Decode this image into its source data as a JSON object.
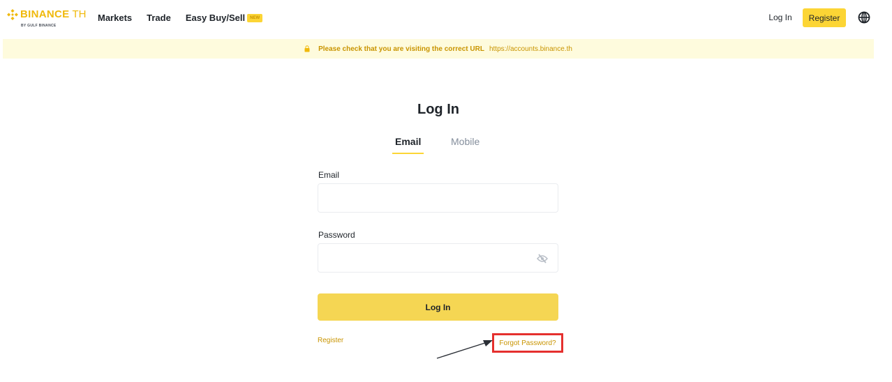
{
  "header": {
    "logo": {
      "word": "BINANCE",
      "suffix": "TH",
      "sub": "BY GULF BINANCE"
    },
    "nav": [
      {
        "label": "Markets"
      },
      {
        "label": "Trade"
      },
      {
        "label": "Easy Buy/Sell"
      }
    ],
    "new_badge": "NEW",
    "login_label": "Log In",
    "register_label": "Register",
    "globe_icon": "globe-icon"
  },
  "notice": {
    "text": "Please check that you are visiting the correct URL",
    "url": "https://accounts.binance.th",
    "icon": "lock-icon"
  },
  "form": {
    "title": "Log In",
    "tabs": [
      {
        "label": "Email",
        "active": true
      },
      {
        "label": "Mobile",
        "active": false
      }
    ],
    "email_label": "Email",
    "email_value": "",
    "password_label": "Password",
    "password_value": "",
    "password_visibility_icon": "eye-slash-icon",
    "submit_label": "Log In",
    "register_link": "Register",
    "forgot_link": "Forgot Password?"
  },
  "colors": {
    "brand": "#f0b90b",
    "button": "#f5d653",
    "link": "#c99400",
    "highlight_box": "#e5302e",
    "notice_bg": "#fefbdd"
  }
}
